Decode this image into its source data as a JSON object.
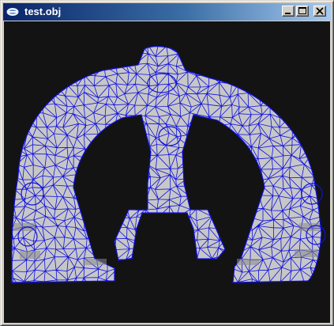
{
  "window": {
    "title": "test.obj",
    "controls": {
      "minimize_icon": "minimize-icon",
      "maximize_icon": "maximize-icon",
      "close_icon": "close-icon"
    }
  },
  "viewport": {
    "background_color": "#131313",
    "mesh_fill_color": "#c7c7c7",
    "wireframe_color": "#1010e0"
  }
}
